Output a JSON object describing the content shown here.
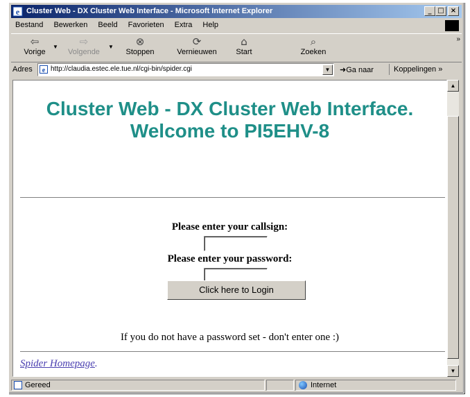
{
  "window": {
    "title": "Cluster Web - DX Cluster Web Interface - Microsoft Internet Explorer",
    "controls": {
      "minimize": "_",
      "maximize": "□",
      "close": "×"
    }
  },
  "menu": [
    "Bestand",
    "Bewerken",
    "Beeld",
    "Favorieten",
    "Extra",
    "Help"
  ],
  "toolbar": {
    "back": "Vorige",
    "forward": "Volgende",
    "stop": "Stoppen",
    "refresh": "Vernieuwen",
    "home": "Start",
    "search": "Zoeken",
    "more": "»"
  },
  "address": {
    "label": "Adres",
    "url": "http://claudia.estec.ele.tue.nl/cgi-bin/spider.cgi",
    "go": "Ga naar",
    "links": "Koppelingen »"
  },
  "page": {
    "heading_line1": "Cluster Web - DX Cluster Web Interface.",
    "heading_line2": "Welcome to PI5EHV-8",
    "callsign_label": "Please enter your callsign:",
    "callsign_value": "",
    "password_label": "Please enter your password:",
    "password_value": "",
    "login_button": "Click here to Login",
    "note": "If you do not have a password set - don't enter one :)",
    "home_link": "Spider Homepage",
    "home_link_suffix": ".",
    "heading_color": "#1f8f88",
    "link_color": "#4a3fb0"
  },
  "status": {
    "text": "Gereed",
    "zone": "Internet"
  }
}
